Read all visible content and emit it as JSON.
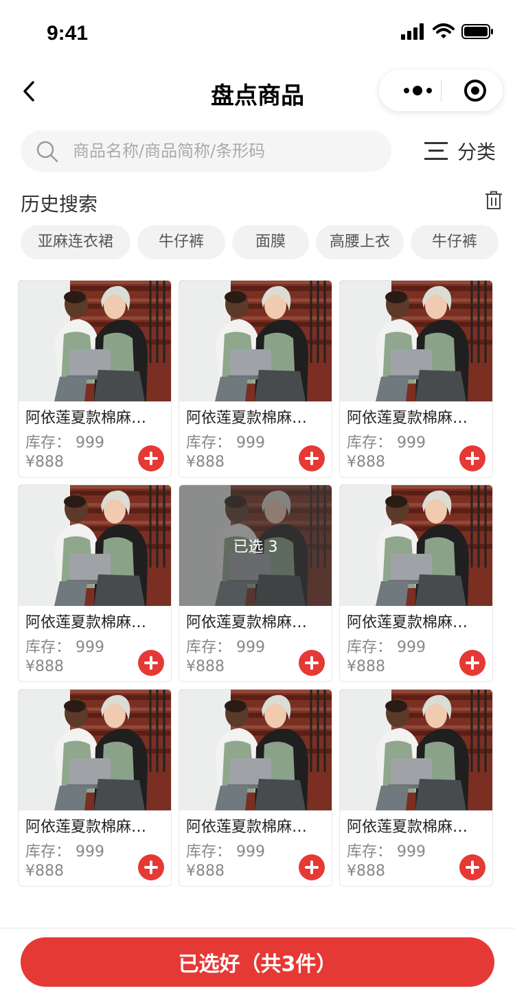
{
  "status_bar": {
    "time": "9:41"
  },
  "nav": {
    "title": "盘点商品"
  },
  "search": {
    "placeholder": "商品名称/商品简称/条形码",
    "value": ""
  },
  "category": {
    "label": "分类"
  },
  "history": {
    "title": "历史搜索",
    "tags": [
      "亚麻连衣裙",
      "牛仔裤",
      "面膜",
      "高腰上衣",
      "牛仔裤"
    ]
  },
  "products": [
    {
      "name": "阿依莲夏款棉麻…",
      "stock": "库存：  999",
      "price": "¥888",
      "selected_label": ""
    },
    {
      "name": "阿依莲夏款棉麻…",
      "stock": "库存：  999",
      "price": "¥888",
      "selected_label": ""
    },
    {
      "name": "阿依莲夏款棉麻…",
      "stock": "库存：  999",
      "price": "¥888",
      "selected_label": ""
    },
    {
      "name": "阿依莲夏款棉麻…",
      "stock": "库存：  999",
      "price": "¥888",
      "selected_label": ""
    },
    {
      "name": "阿依莲夏款棉麻…",
      "stock": "库存：  999",
      "price": "¥888",
      "selected_label": "已选  3"
    },
    {
      "name": "阿依莲夏款棉麻…",
      "stock": "库存：  999",
      "price": "¥888",
      "selected_label": ""
    },
    {
      "name": "阿依莲夏款棉麻…",
      "stock": "库存：  999",
      "price": "¥888",
      "selected_label": ""
    },
    {
      "name": "阿依莲夏款棉麻…",
      "stock": "库存：  999",
      "price": "¥888",
      "selected_label": ""
    },
    {
      "name": "阿依莲夏款棉麻…",
      "stock": "库存：  999",
      "price": "¥888",
      "selected_label": ""
    }
  ],
  "footer": {
    "confirm_label": "已选好（共3件）"
  },
  "colors": {
    "accent": "#e53935",
    "tag_bg": "#f2f2f2",
    "search_bg": "#f5f5f5"
  },
  "icons": {
    "back": "chevron-left-icon",
    "more": "more-dots-icon",
    "close": "target-close-icon",
    "search": "search-icon",
    "category": "menu-lines-icon",
    "trash": "trash-icon",
    "add": "plus-circle-icon"
  }
}
